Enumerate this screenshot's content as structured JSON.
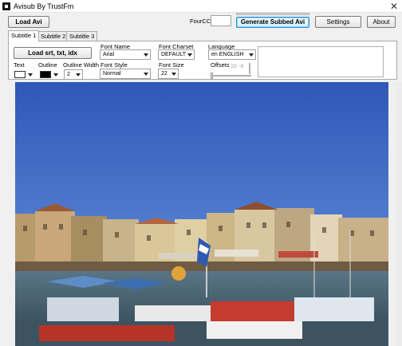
{
  "window": {
    "title": "Avisub By TrustFm",
    "icon": "app-icon",
    "close_glyph": "✕"
  },
  "toolbar": {
    "load_avi_label": "Load Avi",
    "fourcc_label": "FourCC",
    "fourcc_value": "",
    "generate_label": "Generate Subbed Avi",
    "settings_label": "Settings",
    "about_label": "About"
  },
  "tabs": [
    {
      "label": "Subtitle 1",
      "active": true
    },
    {
      "label": "Subtitle 2",
      "active": false
    },
    {
      "label": "Subtitle 3",
      "active": false
    }
  ],
  "subtitle": {
    "load_subs_label": "Load srt, txt, idx",
    "text_label": "Text",
    "outline_label": "Outline",
    "outline_width_label": "Outline Width",
    "outline_width_value": "2",
    "text_color": "#ffffff",
    "outline_color": "#000000",
    "font_name_label": "Font Name",
    "font_name_value": "Arial",
    "font_style_label": "Font Style",
    "font_style_value": "Normal",
    "font_charset_label": "Font Charset",
    "font_charset_value": "DEFAULT",
    "font_size_label": "Font Size",
    "font_size_value": "22",
    "language_label": "Language",
    "language_value": "en ENGLISH",
    "offsets_label": "Offsets",
    "offset_x": "10",
    "offset_y": "-4"
  },
  "preview": {
    "description_icon": "harbor-photo"
  }
}
